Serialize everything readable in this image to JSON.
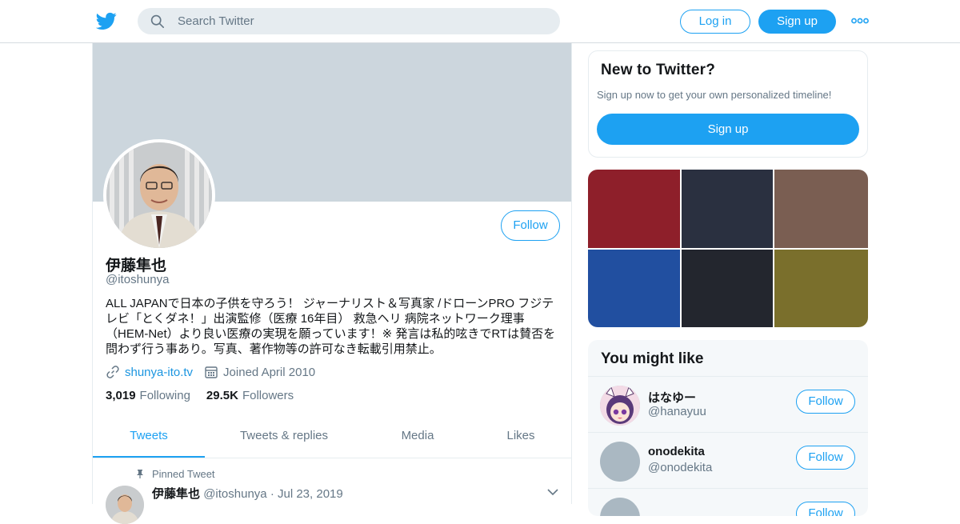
{
  "header": {
    "search_placeholder": "Search Twitter",
    "login_label": "Log in",
    "signup_label": "Sign up",
    "icons": [
      "twitter-bird-icon",
      "search-icon",
      "more-icon"
    ],
    "accent_color": "#1da1f2"
  },
  "profile": {
    "display_name": "伊藤隼也",
    "handle": "@itoshunya",
    "follow_label": "Follow",
    "bio_lines": [
      "ALL JAPANで日本の子供を守ろう！ ジャーナリスト＆写真家 /ドローンPRO フジテ",
      "レビ「とくダネ！」出演監修（医療 16年目） 救急ヘリ 病院ネットワーク理事",
      "（HEM-Net）より良い医療の実現を願っています！※ 発言は私的呟きでRTは賛否を",
      "問わず行う事あり。写真、著作物等の許可なき転載引用禁止。"
    ],
    "website": "shunya-ito.tv",
    "joined": "Joined April 2010",
    "following_count": "3,019",
    "following_label": "Following",
    "followers_count": "29.5K",
    "followers_label": "Followers",
    "banner_color": "#ccd6dd"
  },
  "tabs": [
    {
      "label": "Tweets",
      "active": true
    },
    {
      "label": "Tweets & replies",
      "active": false
    },
    {
      "label": "Media",
      "active": false
    },
    {
      "label": "Likes",
      "active": false
    }
  ],
  "pinned_tweet": {
    "pinned_label": "Pinned Tweet",
    "name": "伊藤隼也",
    "handle": "@itoshunya",
    "separator": "·",
    "date": "Jul 23, 2019"
  },
  "new_card": {
    "title": "New to Twitter?",
    "subtitle": "Sign up now to get your own personalized timeline!",
    "button": "Sign up"
  },
  "media_tiles": [
    {
      "color": "#8e1f2a"
    },
    {
      "color": "#2a3040"
    },
    {
      "color": "#7a5e52"
    },
    {
      "color": "#214fa0"
    },
    {
      "color": "#23262e"
    },
    {
      "color": "#7a6f2c"
    }
  ],
  "you_might_like": {
    "title": "You might like",
    "users": [
      {
        "name": "はなゆー",
        "handle": "@hanayuu",
        "follow": "Follow"
      },
      {
        "name": "onodekita",
        "handle": "@onodekita",
        "follow": "Follow"
      },
      {
        "name": "",
        "handle": "",
        "follow": "Follow"
      }
    ]
  }
}
